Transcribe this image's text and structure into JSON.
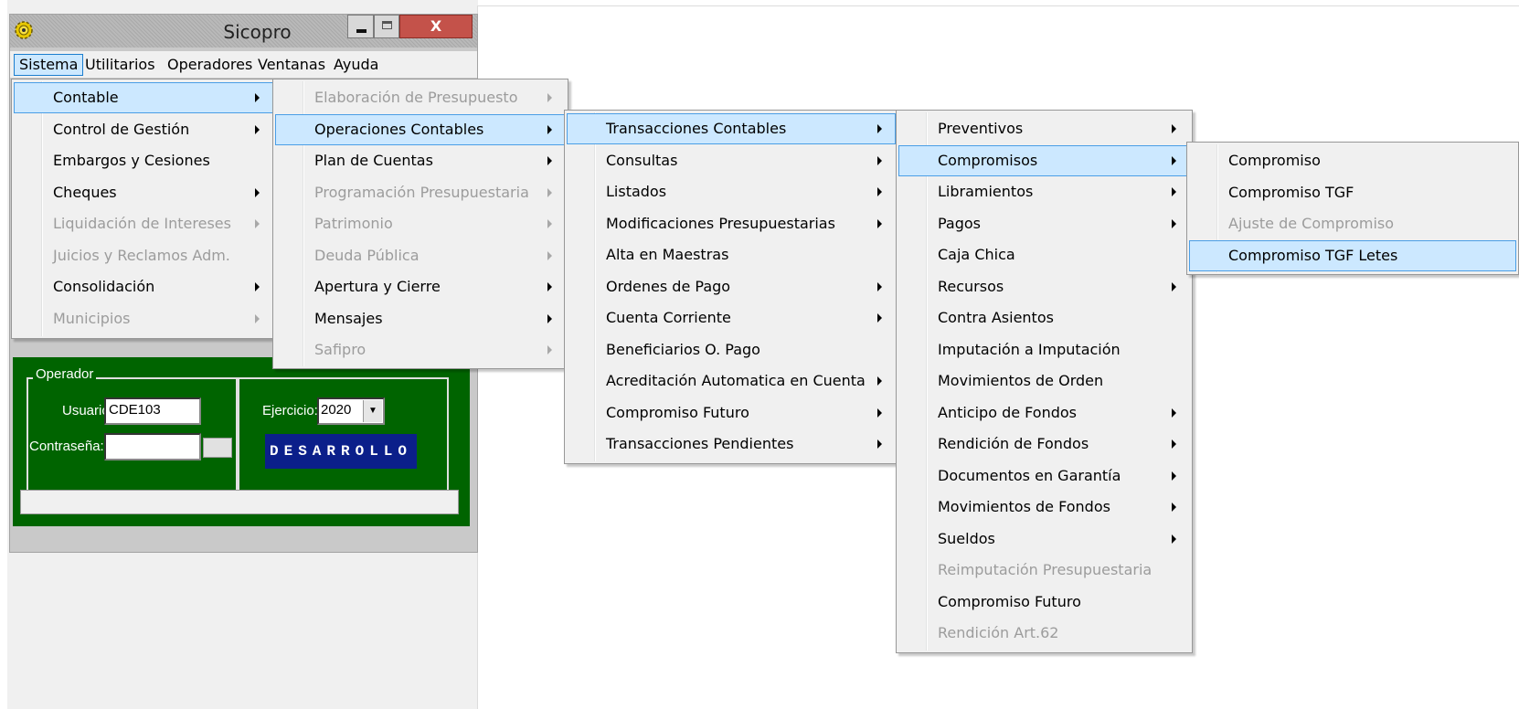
{
  "window": {
    "title": "Sicopro",
    "close_glyph": "X",
    "icons": {
      "app": "gear-app-icon",
      "minimize": "minimize-icon",
      "maximize": "maximize-icon",
      "close": "close-icon"
    }
  },
  "menubar": {
    "items": [
      {
        "label": "Sistema",
        "active": true
      },
      {
        "label": "Utilitarios"
      },
      {
        "label": "Operadores"
      },
      {
        "label": "Ventanas"
      },
      {
        "label": "Ayuda"
      }
    ]
  },
  "login": {
    "group_title": "Operador",
    "user_label": "Usuario:",
    "user_value": "CDE103",
    "password_label": "Contraseña:",
    "password_value": "",
    "year_label": "Ejercicio:",
    "year_value": "2020",
    "environment_badge": "DESARROLLO"
  },
  "menus": {
    "sistema": [
      {
        "label": "Contable",
        "submenu": true,
        "highlighted": true
      },
      {
        "label": "Control de Gestión",
        "submenu": true
      },
      {
        "label": "Embargos y Cesiones"
      },
      {
        "label": "Cheques",
        "submenu": true
      },
      {
        "label": "Liquidación de Intereses",
        "submenu": true,
        "disabled": true
      },
      {
        "label": "Juicios y Reclamos Adm.",
        "disabled": true
      },
      {
        "label": "Consolidación",
        "submenu": true
      },
      {
        "label": "Municipios",
        "submenu": true,
        "disabled": true
      }
    ],
    "contable": [
      {
        "label": "Elaboración de Presupuesto",
        "submenu": true,
        "disabled": true
      },
      {
        "label": "Operaciones Contables",
        "submenu": true,
        "highlighted": true
      },
      {
        "label": "Plan de Cuentas",
        "submenu": true
      },
      {
        "label": "Programación Presupuestaria",
        "submenu": true,
        "disabled": true
      },
      {
        "label": "Patrimonio",
        "submenu": true,
        "disabled": true
      },
      {
        "label": "Deuda Pública",
        "submenu": true,
        "disabled": true
      },
      {
        "label": "Apertura y Cierre",
        "submenu": true
      },
      {
        "label": "Mensajes",
        "submenu": true
      },
      {
        "label": "Safipro",
        "submenu": true,
        "disabled": true
      }
    ],
    "operaciones": [
      {
        "label": "Transacciones Contables",
        "submenu": true,
        "highlighted": true
      },
      {
        "label": "Consultas",
        "submenu": true
      },
      {
        "label": "Listados",
        "submenu": true
      },
      {
        "label": "Modificaciones Presupuestarias",
        "submenu": true
      },
      {
        "label": "Alta en Maestras"
      },
      {
        "label": "Ordenes de Pago",
        "submenu": true
      },
      {
        "label": "Cuenta Corriente",
        "submenu": true
      },
      {
        "label": "Beneficiarios O. Pago"
      },
      {
        "label": "Acreditación Automatica en Cuenta",
        "submenu": true
      },
      {
        "label": "Compromiso Futuro",
        "submenu": true
      },
      {
        "label": "Transacciones Pendientes",
        "submenu": true
      }
    ],
    "transacciones": [
      {
        "label": "Preventivos",
        "submenu": true
      },
      {
        "label": "Compromisos",
        "submenu": true,
        "highlighted": true
      },
      {
        "label": "Libramientos",
        "submenu": true
      },
      {
        "label": "Pagos",
        "submenu": true
      },
      {
        "label": "Caja Chica"
      },
      {
        "label": "Recursos",
        "submenu": true
      },
      {
        "label": "Contra Asientos"
      },
      {
        "label": "Imputación a Imputación"
      },
      {
        "label": "Movimientos de Orden"
      },
      {
        "label": "Anticipo de Fondos",
        "submenu": true
      },
      {
        "label": "Rendición de Fondos",
        "submenu": true
      },
      {
        "label": "Documentos en Garantía",
        "submenu": true
      },
      {
        "label": "Movimientos de Fondos",
        "submenu": true
      },
      {
        "label": "Sueldos",
        "submenu": true
      },
      {
        "label": "Reimputación Presupuestaria",
        "disabled": true
      },
      {
        "label": "Compromiso Futuro"
      },
      {
        "label": "Rendición Art.62",
        "disabled": true
      }
    ],
    "compromisos": [
      {
        "label": "Compromiso"
      },
      {
        "label": "Compromiso TGF"
      },
      {
        "label": "Ajuste de Compromiso",
        "disabled": true
      },
      {
        "label": "Compromiso TGF Letes",
        "highlighted": true
      }
    ]
  }
}
